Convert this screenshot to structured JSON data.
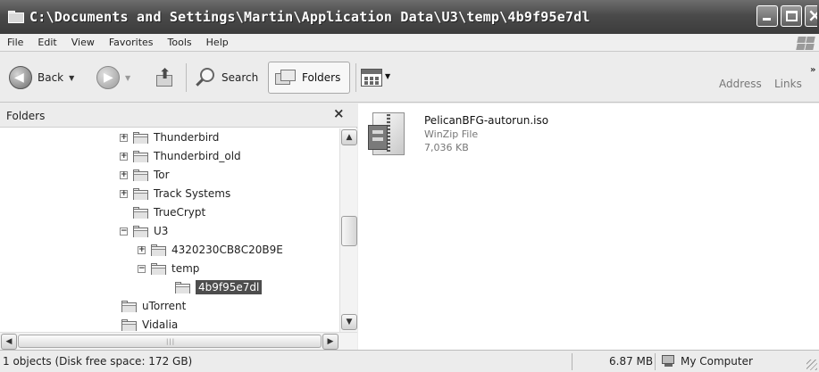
{
  "window": {
    "title": "C:\\Documents and Settings\\Martin\\Application Data\\U3\\temp\\4b9f95e7dl"
  },
  "menu": [
    "File",
    "Edit",
    "View",
    "Favorites",
    "Tools",
    "Help"
  ],
  "toolbar": {
    "back_label": "Back",
    "search_label": "Search",
    "folders_label": "Folders",
    "address_label": "Address",
    "links_label": "Links",
    "overflow": "»"
  },
  "folders_pane": {
    "title": "Folders",
    "close": "×",
    "tree": [
      {
        "label": "Thunderbird",
        "expander": "+"
      },
      {
        "label": "Thunderbird_old",
        "expander": "+"
      },
      {
        "label": "Tor",
        "expander": "+"
      },
      {
        "label": "Track Systems",
        "expander": "+"
      },
      {
        "label": "TrueCrypt",
        "expander": ""
      },
      {
        "label": "U3",
        "expander": "−"
      },
      {
        "label": "4320230CB8C20B9E",
        "expander": "+"
      },
      {
        "label": "temp",
        "expander": "−"
      },
      {
        "label": "4b9f95e7dl",
        "expander": "",
        "selected": true
      },
      {
        "label": "uTorrent",
        "expander": ""
      },
      {
        "label": "Vidalia",
        "expander": ""
      }
    ]
  },
  "files": [
    {
      "name": "PelicanBFG-autorun.iso",
      "type": "WinZip File",
      "size": "7,036 KB",
      "icon": "winzip-icon"
    }
  ],
  "statusbar": {
    "objects": "1 objects (Disk free space: 172 GB)",
    "size": "6.87 MB",
    "location": "My Computer"
  }
}
